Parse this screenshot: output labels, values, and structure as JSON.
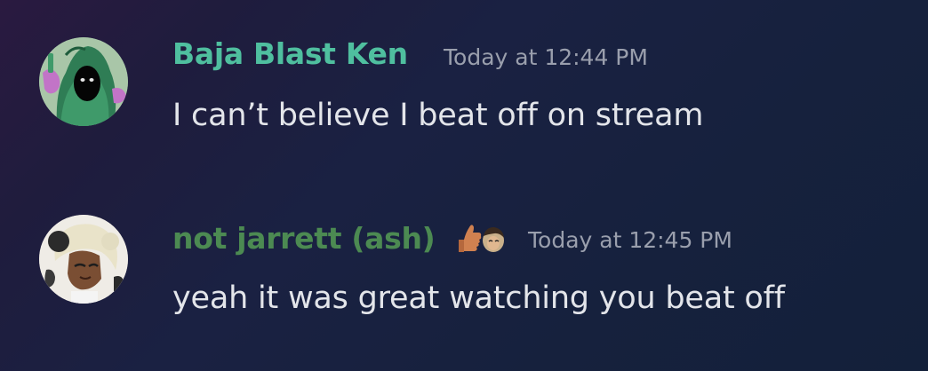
{
  "messages": [
    {
      "author": "Baja Blast Ken",
      "author_color": "#4fbf9f",
      "timestamp": "Today at 12:44 PM",
      "text": "I can’t believe I beat off on stream",
      "avatar_icon": "hooded-figure-avatar"
    },
    {
      "author": "not jarrett (ash)",
      "author_color": "#4c8a52",
      "timestamp": "Today at 12:45 PM",
      "text": "yeah it was great watching you beat off",
      "avatar_icon": "anime-character-avatar",
      "role_icon": "thumbs-up-emoji-icon"
    }
  ]
}
